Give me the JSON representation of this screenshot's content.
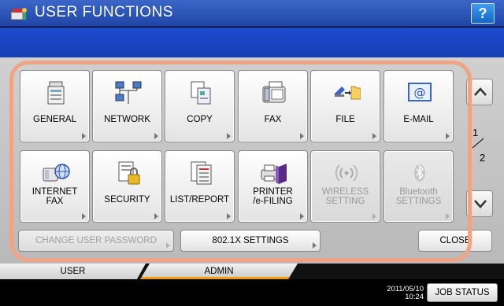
{
  "header": {
    "title": "USER FUNCTIONS",
    "help_label": "?"
  },
  "tiles_row1": [
    {
      "label": "GENERAL",
      "icon": "copier-icon"
    },
    {
      "label": "NETWORK",
      "icon": "network-icon"
    },
    {
      "label": "COPY",
      "icon": "copy-icon"
    },
    {
      "label": "FAX",
      "icon": "fax-icon"
    },
    {
      "label": "FILE",
      "icon": "scan-to-folder-icon"
    },
    {
      "label": "E-MAIL",
      "icon": "email-icon"
    }
  ],
  "tiles_row2": [
    {
      "line1": "INTERNET",
      "line2": "FAX",
      "icon": "internet-fax-icon"
    },
    {
      "label": "SECURITY",
      "icon": "security-lock-icon"
    },
    {
      "label": "LIST/REPORT",
      "icon": "list-report-icon"
    },
    {
      "line1": "PRINTER",
      "line2": "/e-FILING",
      "icon": "printer-efiling-icon"
    },
    {
      "line1": "WIRELESS",
      "line2": "SETTING",
      "icon": "wireless-icon",
      "disabled": true
    },
    {
      "line1": "Bluetooth",
      "line2": "SETTINGS",
      "icon": "bluetooth-icon",
      "disabled": true
    }
  ],
  "pager": {
    "current": "1",
    "total": "2"
  },
  "bottom_buttons": {
    "change_password": "CHANGE USER PASSWORD",
    "dot1x": "802.1X SETTINGS",
    "close": "CLOSE"
  },
  "tabs": {
    "user": "USER",
    "admin": "ADMIN"
  },
  "status": {
    "date": "2011/05/10",
    "time": "10:24",
    "job_status": "JOB STATUS"
  },
  "colors": {
    "accent_frame": "#f0a486",
    "title_blue": "#2a53b8",
    "admin_tab_underline": "#f0a000"
  }
}
